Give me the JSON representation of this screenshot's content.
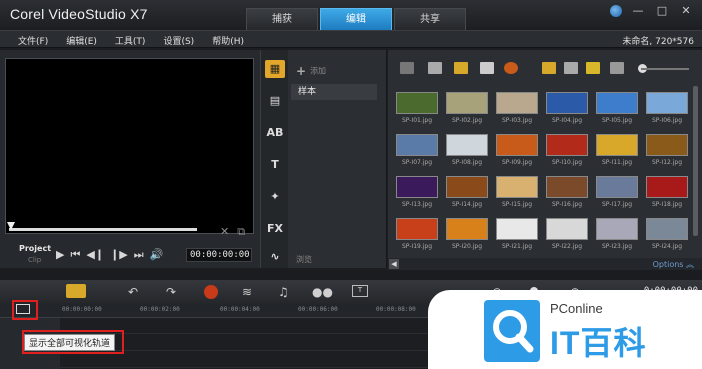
{
  "app": {
    "title": "Corel VideoStudio X7",
    "project_info": "未命名, 720*576"
  },
  "tabs": [
    {
      "label": "捕获",
      "active": false
    },
    {
      "label": "编辑",
      "active": true
    },
    {
      "label": "共享",
      "active": false
    }
  ],
  "menu": [
    "文件(F)",
    "编辑(E)",
    "工具(T)",
    "设置(S)",
    "帮助(H)"
  ],
  "window_buttons": [
    "?",
    "—",
    "□",
    "✕"
  ],
  "preview": {
    "project_label": "Project",
    "clip_label": "Clip",
    "timecode": "00:00:00:00",
    "trim_icons": [
      "✕",
      "⧉"
    ],
    "controls": [
      "▶",
      "⏮",
      "◀❙",
      "❙▶",
      "⏭",
      "🔊"
    ]
  },
  "side_toolbar": [
    "▦",
    "▤",
    "AB",
    "T",
    "✦",
    "FX",
    "∿"
  ],
  "library": {
    "add_label": "添加",
    "folder": "样本",
    "browse_label": "浏览",
    "options_label": "Options ︽",
    "thumbnails": [
      {
        "label": "SP-I01.jpg",
        "color": "#4a6a2e"
      },
      {
        "label": "SP-I02.jpg",
        "color": "#a8a27a"
      },
      {
        "label": "SP-I03.jpg",
        "color": "#b9a78e"
      },
      {
        "label": "SP-I04.jpg",
        "color": "#2a5aa8"
      },
      {
        "label": "SP-I05.jpg",
        "color": "#3d7dcc"
      },
      {
        "label": "SP-I06.jpg",
        "color": "#7aa8d8"
      },
      {
        "label": "SP-I07.jpg",
        "color": "#5a7aa8"
      },
      {
        "label": "SP-I08.jpg",
        "color": "#cfd6dc"
      },
      {
        "label": "SP-I09.jpg",
        "color": "#c85a1a"
      },
      {
        "label": "SP-I10.jpg",
        "color": "#b22a1a"
      },
      {
        "label": "SP-I11.jpg",
        "color": "#d8a82a"
      },
      {
        "label": "SP-I12.jpg",
        "color": "#8a5a1a"
      },
      {
        "label": "SP-I13.jpg",
        "color": "#3a1a5a"
      },
      {
        "label": "SP-I14.jpg",
        "color": "#8a4a1a"
      },
      {
        "label": "SP-I15.jpg",
        "color": "#d8b070"
      },
      {
        "label": "SP-I16.jpg",
        "color": "#7a4a2a"
      },
      {
        "label": "SP-I17.jpg",
        "color": "#6a7a9a"
      },
      {
        "label": "SP-I18.jpg",
        "color": "#a81a1a"
      },
      {
        "label": "SP-I19.jpg",
        "color": "#c8401a"
      },
      {
        "label": "SP-I20.jpg",
        "color": "#d8801a"
      },
      {
        "label": "SP-I21.jpg",
        "color": "#e8e8e8"
      },
      {
        "label": "SP-I22.jpg",
        "color": "#d8d8d8"
      },
      {
        "label": "SP-I23.jpg",
        "color": "#a8a8b8"
      },
      {
        "label": "SP-I24.jpg",
        "color": "#7a8898"
      }
    ]
  },
  "timeline": {
    "timecode": "0:00:00:00",
    "ruler": [
      "00:00:00:00",
      "00:00:02:00",
      "00:00:04:00",
      "00:00:06:00",
      "00:00:08:00"
    ],
    "tooltip": "显示全部可视化轨道"
  },
  "watermark": {
    "brand": "PConline",
    "name": "IT百科"
  }
}
